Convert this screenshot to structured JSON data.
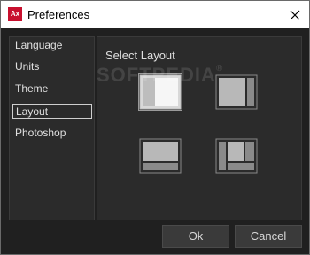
{
  "window": {
    "title": "Preferences",
    "app_icon_text": "Ax",
    "close_icon": "close-icon"
  },
  "sidebar": {
    "items": [
      {
        "label": "Language",
        "selected": false
      },
      {
        "label": "Units",
        "selected": false
      },
      {
        "label": "Theme",
        "selected": false
      },
      {
        "label": "Layout",
        "selected": true
      },
      {
        "label": "Photoshop",
        "selected": false
      }
    ]
  },
  "main": {
    "section_title": "Select Layout",
    "layout_options": [
      {
        "name": "layout-option-1",
        "selected": true
      },
      {
        "name": "layout-option-2",
        "selected": false
      },
      {
        "name": "layout-option-3",
        "selected": false
      },
      {
        "name": "layout-option-4",
        "selected": false
      }
    ]
  },
  "footer": {
    "ok_label": "Ok",
    "cancel_label": "Cancel"
  },
  "watermark": {
    "text": "SOFTPEDIA",
    "mark": "®"
  },
  "colors": {
    "accent": "#c8102e",
    "background": "#202020",
    "panel": "#2b2b2b",
    "text": "#e0e0e0"
  }
}
